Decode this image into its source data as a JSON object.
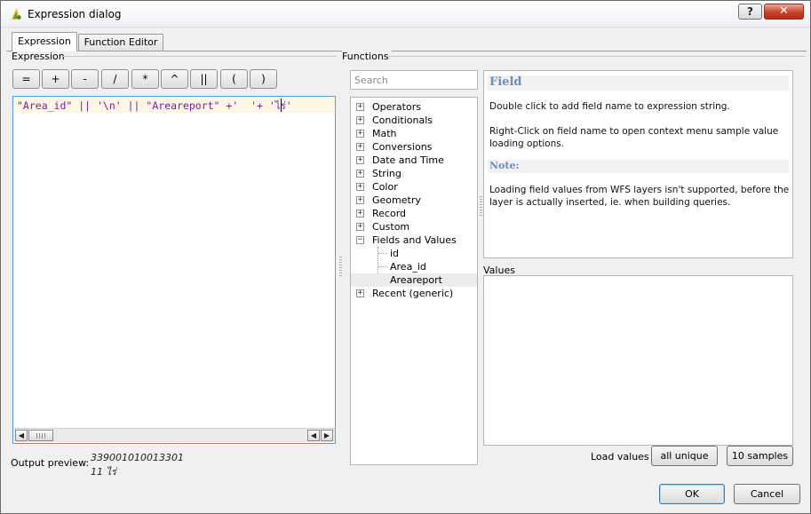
{
  "window": {
    "title": "Expression dialog",
    "help_label": "?",
    "close_label": "✕"
  },
  "tabs": [
    {
      "label": "Expression",
      "active": true
    },
    {
      "label": "Function Editor",
      "active": false
    }
  ],
  "expression_section": {
    "label": "Expression",
    "operators": [
      "=",
      "+",
      "-",
      "/",
      "*",
      "^",
      "||",
      "(",
      ")"
    ],
    "text": "\"Area_id\" || '\\n' || \"Areareport\" +'  '+ 'ไร่'",
    "output_preview_label": "Output preview:",
    "output_preview_lines": [
      "339001010013301",
      "11  ไร่"
    ]
  },
  "functions_section": {
    "label": "Functions",
    "search_placeholder": "Search",
    "tree": [
      {
        "label": "Operators",
        "expanded": false
      },
      {
        "label": "Conditionals",
        "expanded": false
      },
      {
        "label": "Math",
        "expanded": false
      },
      {
        "label": "Conversions",
        "expanded": false
      },
      {
        "label": "Date and Time",
        "expanded": false
      },
      {
        "label": "String",
        "expanded": false
      },
      {
        "label": "Color",
        "expanded": false
      },
      {
        "label": "Geometry",
        "expanded": false
      },
      {
        "label": "Record",
        "expanded": false
      },
      {
        "label": "Custom",
        "expanded": false
      },
      {
        "label": "Fields and Values",
        "expanded": true,
        "children": [
          {
            "label": "id",
            "selected": false
          },
          {
            "label": "Area_id",
            "selected": false
          },
          {
            "label": "Areareport",
            "selected": true
          }
        ]
      },
      {
        "label": "Recent (generic)",
        "expanded": false
      }
    ]
  },
  "help": {
    "heading": "Field",
    "p1": "Double click to add field name to expression string.",
    "p2": "Right-Click on field name to open context menu sample value loading options.",
    "note_heading": "Note:",
    "p3": "Loading field values from WFS layers isn't supported, before the layer is actually inserted, ie. when building queries."
  },
  "values": {
    "label": "Values",
    "load_values_label": "Load values",
    "all_unique_label": "all unique",
    "samples_label": "10 samples"
  },
  "footer": {
    "ok_label": "OK",
    "cancel_label": "Cancel"
  },
  "colors": {
    "expression_text": "#7b1fa2",
    "help_heading": "#6e8eb3",
    "editor_border": "#569de5"
  }
}
